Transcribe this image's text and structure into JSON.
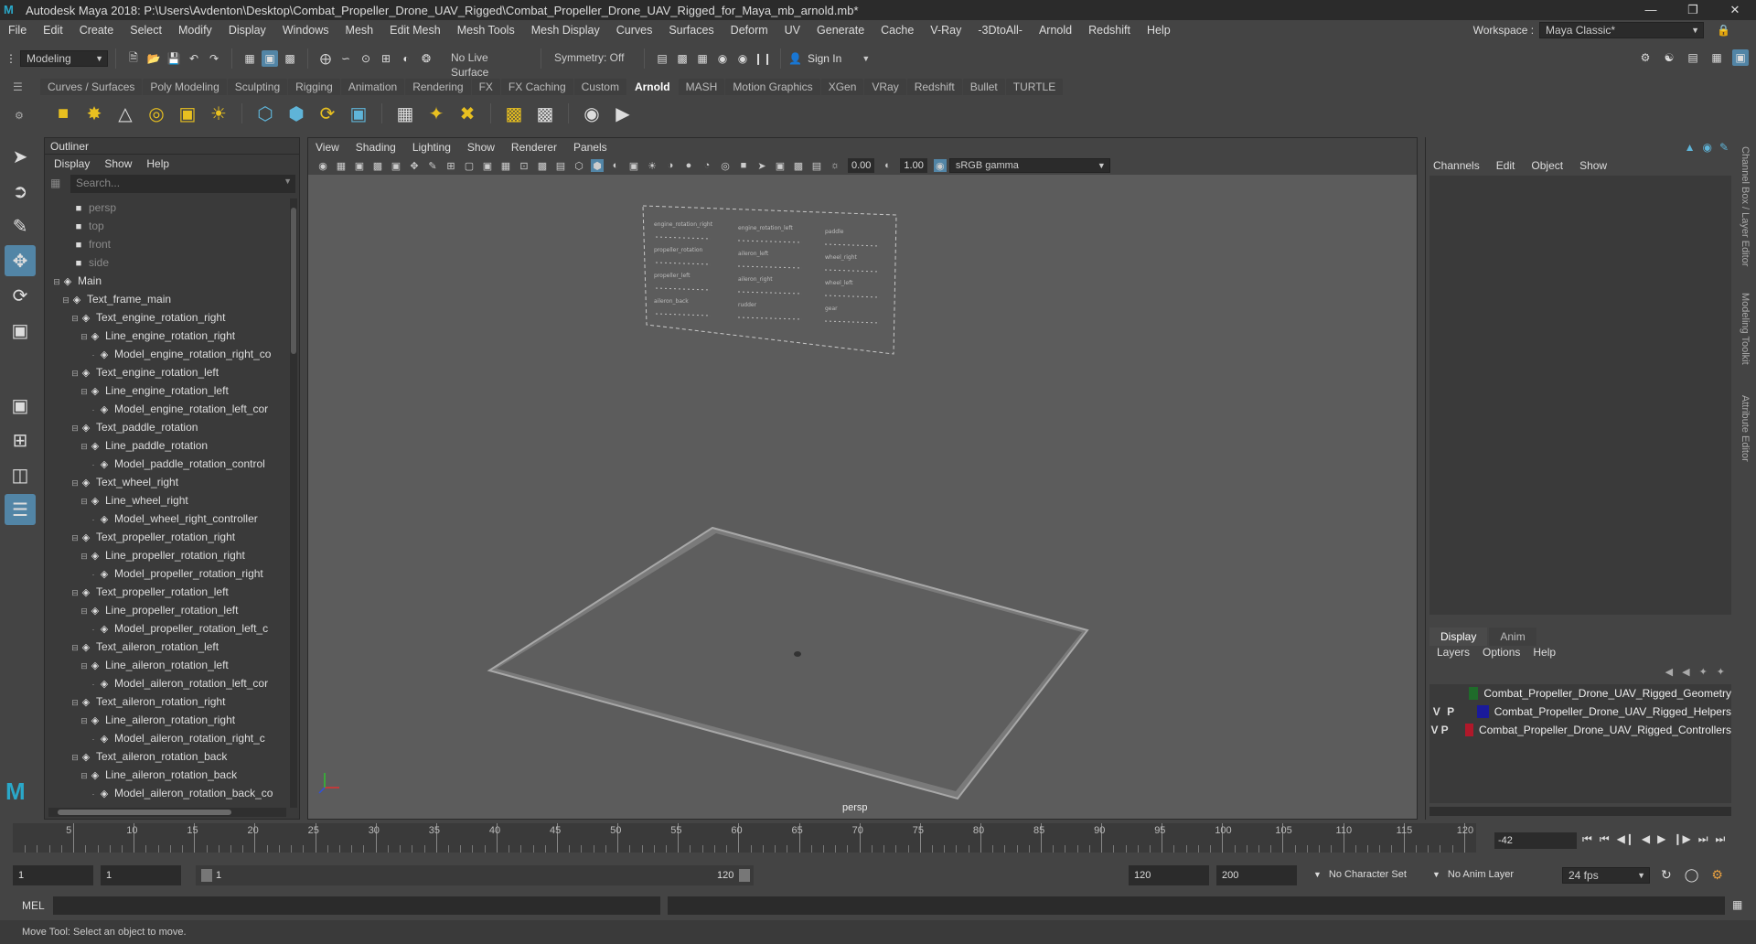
{
  "title": "Autodesk Maya 2018: P:\\Users\\Avdenton\\Desktop\\Combat_Propeller_Drone_UAV_Rigged\\Combat_Propeller_Drone_UAV_Rigged_for_Maya_mb_arnold.mb*",
  "menubar": [
    "File",
    "Edit",
    "Create",
    "Select",
    "Modify",
    "Display",
    "Windows",
    "Mesh",
    "Edit Mesh",
    "Mesh Tools",
    "Mesh Display",
    "Curves",
    "Surfaces",
    "Deform",
    "UV",
    "Generate",
    "Cache",
    "V-Ray",
    "-3DtoAll-",
    "Arnold",
    "Redshift",
    "Help"
  ],
  "workspace": {
    "label": "Workspace :",
    "value": "Maya Classic*"
  },
  "statusline": {
    "mode": "Modeling",
    "live_surface": "No Live Surface",
    "symmetry": "Symmetry: Off",
    "sign_in": "Sign In"
  },
  "shelf_tabs": [
    "Curves / Surfaces",
    "Poly Modeling",
    "Sculpting",
    "Rigging",
    "Animation",
    "Rendering",
    "FX",
    "FX Caching",
    "Custom",
    "Arnold",
    "MASH",
    "Motion Graphics",
    "XGen",
    "VRay",
    "Redshift",
    "Bullet",
    "TURTLE"
  ],
  "active_shelf": "Arnold",
  "outliner": {
    "tab": "Outliner",
    "menu": [
      "Display",
      "Show",
      "Help"
    ],
    "search_placeholder": "Search...",
    "items": [
      {
        "label": "persp",
        "depth": 0,
        "type": "camera"
      },
      {
        "label": "top",
        "depth": 0,
        "type": "camera"
      },
      {
        "label": "front",
        "depth": 0,
        "type": "camera"
      },
      {
        "label": "side",
        "depth": 0,
        "type": "camera"
      },
      {
        "label": "Main",
        "depth": 0,
        "type": "node",
        "expanded": true
      },
      {
        "label": "Text_frame_main",
        "depth": 1,
        "type": "node",
        "expanded": true
      },
      {
        "label": "Text_engine_rotation_right",
        "depth": 2,
        "type": "node",
        "expanded": true
      },
      {
        "label": "Line_engine_rotation_right",
        "depth": 3,
        "type": "node",
        "expanded": true
      },
      {
        "label": "Model_engine_rotation_right_co",
        "depth": 4,
        "type": "leaf"
      },
      {
        "label": "Text_engine_rotation_left",
        "depth": 2,
        "type": "node",
        "expanded": true
      },
      {
        "label": "Line_engine_rotation_left",
        "depth": 3,
        "type": "node",
        "expanded": true
      },
      {
        "label": "Model_engine_rotation_left_cor",
        "depth": 4,
        "type": "leaf"
      },
      {
        "label": "Text_paddle_rotation",
        "depth": 2,
        "type": "node",
        "expanded": true
      },
      {
        "label": "Line_paddle_rotation",
        "depth": 3,
        "type": "node",
        "expanded": true
      },
      {
        "label": "Model_paddle_rotation_control",
        "depth": 4,
        "type": "leaf"
      },
      {
        "label": "Text_wheel_right",
        "depth": 2,
        "type": "node",
        "expanded": true
      },
      {
        "label": "Line_wheel_right",
        "depth": 3,
        "type": "node",
        "expanded": true
      },
      {
        "label": "Model_wheel_right_controller",
        "depth": 4,
        "type": "leaf"
      },
      {
        "label": "Text_propeller_rotation_right",
        "depth": 2,
        "type": "node",
        "expanded": true
      },
      {
        "label": "Line_propeller_rotation_right",
        "depth": 3,
        "type": "node",
        "expanded": true
      },
      {
        "label": "Model_propeller_rotation_right",
        "depth": 4,
        "type": "leaf"
      },
      {
        "label": "Text_propeller_rotation_left",
        "depth": 2,
        "type": "node",
        "expanded": true
      },
      {
        "label": "Line_propeller_rotation_left",
        "depth": 3,
        "type": "node",
        "expanded": true
      },
      {
        "label": "Model_propeller_rotation_left_c",
        "depth": 4,
        "type": "leaf"
      },
      {
        "label": "Text_aileron_rotation_left",
        "depth": 2,
        "type": "node",
        "expanded": true
      },
      {
        "label": "Line_aileron_rotation_left",
        "depth": 3,
        "type": "node",
        "expanded": true
      },
      {
        "label": "Model_aileron_rotation_left_cor",
        "depth": 4,
        "type": "leaf"
      },
      {
        "label": "Text_aileron_rotation_right",
        "depth": 2,
        "type": "node",
        "expanded": true
      },
      {
        "label": "Line_aileron_rotation_right",
        "depth": 3,
        "type": "node",
        "expanded": true
      },
      {
        "label": "Model_aileron_rotation_right_c",
        "depth": 4,
        "type": "leaf"
      },
      {
        "label": "Text_aileron_rotation_back",
        "depth": 2,
        "type": "node",
        "expanded": true
      },
      {
        "label": "Line_aileron_rotation_back",
        "depth": 3,
        "type": "node",
        "expanded": true
      },
      {
        "label": "Model_aileron_rotation_back_co",
        "depth": 4,
        "type": "leaf"
      }
    ]
  },
  "viewport": {
    "menu": [
      "View",
      "Shading",
      "Lighting",
      "Show",
      "Renderer",
      "Panels"
    ],
    "field1": "0.00",
    "field2": "1.00",
    "colorspace": "sRGB gamma",
    "camera_label": "persp"
  },
  "channel_box": {
    "menu": [
      "Channels",
      "Edit",
      "Object",
      "Show"
    ],
    "layer_tabs": [
      "Display",
      "Anim"
    ],
    "layer_menu": [
      "Layers",
      "Options",
      "Help"
    ],
    "layers": [
      {
        "v": "",
        "p": "",
        "name": "Combat_Propeller_Drone_UAV_Rigged_Geometry",
        "color": "#1f6b2a"
      },
      {
        "v": "V",
        "p": "P",
        "name": "Combat_Propeller_Drone_UAV_Rigged_Helpers",
        "color": "#1a1a9a"
      },
      {
        "v": "V",
        "p": "P",
        "name": "Combat_Propeller_Drone_UAV_Rigged_Controllers",
        "color": "#b0182a"
      }
    ]
  },
  "side_tabs": [
    "Channel Box / Layer Editor",
    "Modeling Toolkit",
    "Attribute Editor"
  ],
  "timeline": {
    "ticks": [
      5,
      10,
      15,
      20,
      25,
      30,
      35,
      40,
      45,
      50,
      55,
      60,
      65,
      70,
      75,
      80,
      85,
      90,
      95,
      100,
      105,
      110,
      115,
      120
    ],
    "current_frame": "-42"
  },
  "range": {
    "start": "1",
    "start2": "1",
    "slider_start": "1",
    "slider_end": "120",
    "end": "120",
    "end2": "200",
    "character_set": "No Character Set",
    "anim_layer": "No Anim Layer",
    "fps": "24 fps"
  },
  "command": {
    "label": "MEL"
  },
  "help_line": "Move Tool: Select an object to move."
}
